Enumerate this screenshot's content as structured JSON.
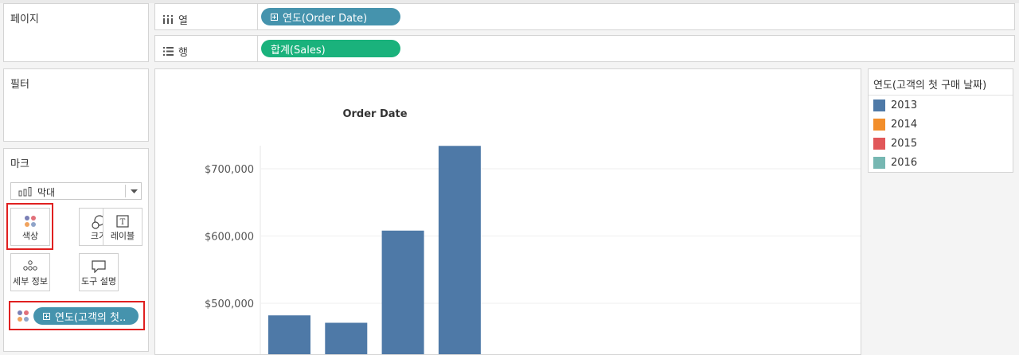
{
  "pages_card": {
    "title": "페이지"
  },
  "filters_card": {
    "title": "필터"
  },
  "marks_card": {
    "title": "마크",
    "mark_type": "막대",
    "buttons": {
      "color": "색상",
      "size": "크기",
      "label": "레이블",
      "detail": "세부 정보",
      "tooltip": "도구 설명"
    },
    "color_pill": "연도(고객의 첫.."
  },
  "shelves": {
    "columns": {
      "label": "열",
      "pill": "연도(Order Date)"
    },
    "rows": {
      "label": "행",
      "pill": "합계(Sales)"
    }
  },
  "legend": {
    "title": "연도(고객의 첫 구매 날짜)",
    "items": [
      {
        "label": "2013",
        "color": "#4e79a7"
      },
      {
        "label": "2014",
        "color": "#f28e2b"
      },
      {
        "label": "2015",
        "color": "#e15759"
      },
      {
        "label": "2016",
        "color": "#76b7b2"
      }
    ]
  },
  "colors": {
    "pill_blue": "#4593ad",
    "pill_green": "#1ab27c",
    "highlight": "#e02020"
  },
  "chart_data": {
    "type": "bar",
    "title": "Order Date",
    "categories": [
      "",
      "",
      "",
      ""
    ],
    "values": [
      482000,
      471000,
      608000,
      734000
    ],
    "bar_color": "#4e79a7",
    "yticks": [
      500000,
      600000,
      700000
    ],
    "ytick_labels": [
      "$500,000",
      "$600,000",
      "$700,000"
    ],
    "ylim": [
      440000,
      760000
    ],
    "grid": true
  }
}
